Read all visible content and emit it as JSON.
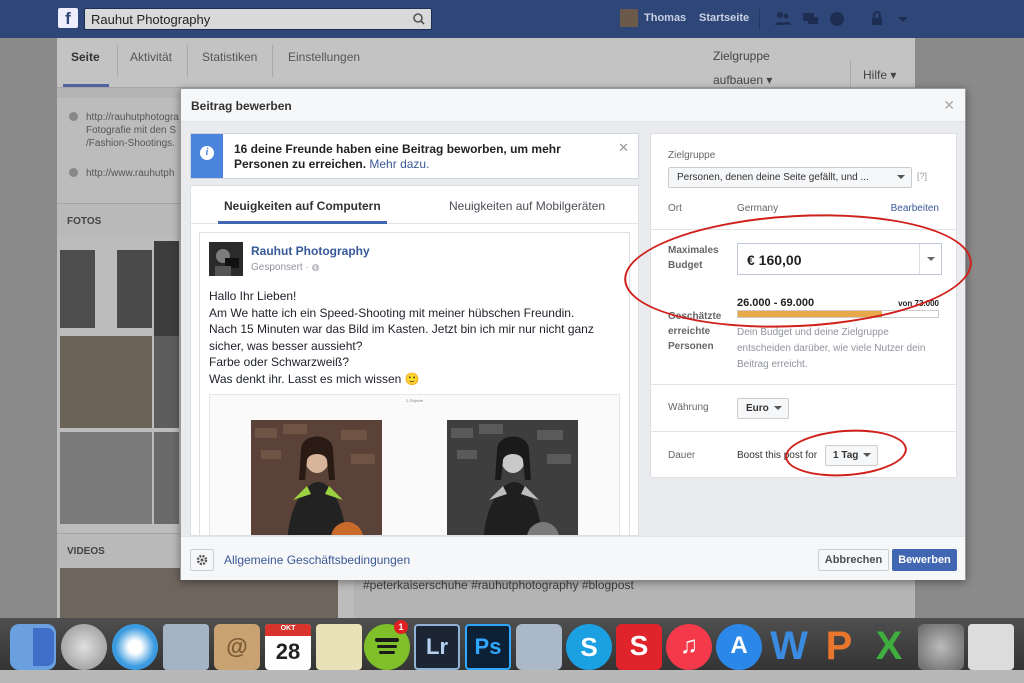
{
  "topbar": {
    "search_value": "Rauhut Photography",
    "user_name": "Thomas",
    "home_label": "Startseite"
  },
  "page": {
    "tabs": [
      "Seite",
      "Aktivität",
      "Statistiken",
      "Einstellungen"
    ],
    "zielgruppe_line1": "Zielgruppe",
    "zielgruppe_line2": "aufbauen ▾",
    "hilfe": "Hilfe ▾",
    "about": [
      {
        "lines": [
          "http://rauhutphotogra",
          "Fotografie mit den S",
          "/Fashion-Shootings."
        ]
      },
      {
        "lines": [
          "http://www.rauhutph"
        ]
      }
    ],
    "fotos_label": "FOTOS",
    "videos_label": "VIDEOS",
    "hashtags": "#peterkaiserschuhe #rauhutphotography #blogpost"
  },
  "modal": {
    "title": "Beitrag bewerben",
    "notice_text": "16 deine Freunde haben eine Beitrag beworben, um mehr Personen zu erreichen.",
    "notice_link": "Mehr dazu.",
    "preview_tabs": [
      "Neuigkeiten auf Computern",
      "Neuigkeiten auf Mobilgeräten"
    ],
    "post": {
      "page_name": "Rauhut Photography",
      "sponsored": "Gesponsert ·",
      "lines": [
        "Hallo Ihr Lieben!",
        "Am We hatte ich ein Speed-Shooting mit meiner hübschen Freundin.",
        "Nach 15 Minuten war das Bild im Kasten. Jetzt bin ich mir nur nicht ganz",
        "sicher, was besser aussieht?",
        "Farbe oder Schwarzweiß?",
        "Was denkt ihr. Lasst es mich wissen 🙂"
      ],
      "photos_count": "2 Objekte"
    },
    "settings": {
      "zielgruppe_label": "Zielgruppe",
      "zielgruppe_value": "Personen, denen deine Seite gefällt, und ...",
      "help": "[?]",
      "ort_label": "Ort",
      "ort_value": "Germany",
      "bearbeiten": "Bearbeiten",
      "budget_label_1": "Maximales",
      "budget_label_2": "Budget",
      "budget_value": "€ 160,00",
      "reach_label_1": "Geschätzte",
      "reach_label_2": "erreichte",
      "reach_label_3": "Personen",
      "reach_range": "26.000 - 69.000",
      "reach_max": "von 73.000",
      "reach_fraction": 0.72,
      "reach_desc": "Dein Budget und deine Zielgruppe entscheiden darüber, wie viele Nutzer dein Beitrag erreicht.",
      "currency_label": "Währung",
      "currency_value": "Euro",
      "duration_label": "Dauer",
      "duration_text": "Boost this post for",
      "duration_value": "1 Tag"
    },
    "footer": {
      "terms_link": "Allgemeine Geschäftsbedingungen",
      "cancel": "Abbrechen",
      "submit": "Bewerben"
    }
  },
  "dock": {
    "lr_label": "Lr",
    "ps_label": "Ps",
    "calendar_month": "OKT",
    "calendar_day": "28",
    "spotify_badge": "1",
    "word_letter": "W",
    "powerpoint_letter": "P",
    "excel_letter": "X"
  },
  "colors": {
    "fb_blue": "#3b5998",
    "primary_button": "#4267b2",
    "reach_bar": "#e8a94b",
    "annotation_red": "#d0201b"
  }
}
